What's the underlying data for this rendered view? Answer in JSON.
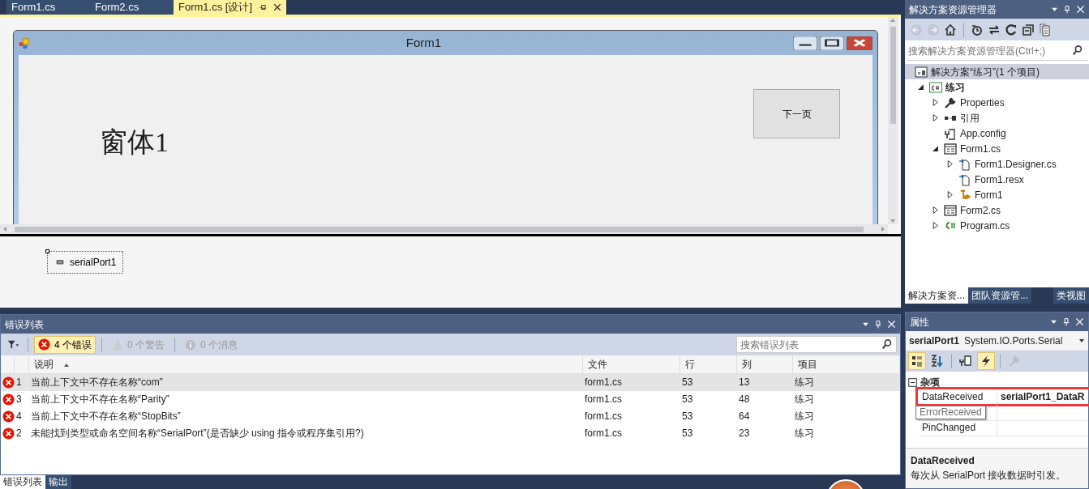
{
  "document_tabs": [
    {
      "label": "Form1.cs",
      "selected": false
    },
    {
      "label": "Form2.cs",
      "selected": false
    },
    {
      "label": "Form1.cs [设计]",
      "selected": true
    }
  ],
  "designer": {
    "form": {
      "title": "Form1",
      "label": "窗体1",
      "button": "下一页"
    },
    "tray": [
      {
        "label": "serialPort1",
        "selected": true
      }
    ]
  },
  "error_list": {
    "title": "错误列表",
    "filters": [
      {
        "kind": "error",
        "label": "4 个错误",
        "selected": true
      },
      {
        "kind": "warning",
        "label": "0 个警告",
        "selected": false
      },
      {
        "kind": "info",
        "label": "0 个消息",
        "selected": false
      }
    ],
    "search": {
      "placeholder": "搜索错误列表"
    },
    "columns": [
      "说明",
      "文件",
      "行",
      "列",
      "项目"
    ],
    "rows": [
      {
        "number": "1",
        "description": "当前上下文中不存在名称“com”",
        "file": "form1.cs",
        "line": "53",
        "column": "13",
        "project": "练习",
        "selected": true
      },
      {
        "number": "3",
        "description": "当前上下文中不存在名称“Parity”",
        "file": "form1.cs",
        "line": "53",
        "column": "48",
        "project": "练习",
        "selected": false
      },
      {
        "number": "4",
        "description": "当前上下文中不存在名称“StopBits”",
        "file": "form1.cs",
        "line": "53",
        "column": "64",
        "project": "练习",
        "selected": false
      },
      {
        "number": "2",
        "description": "未能找到类型或命名空间名称“SerialPort”(是否缺少 using 指令或程序集引用?)",
        "file": "form1.cs",
        "line": "53",
        "column": "23",
        "project": "练习",
        "selected": false
      }
    ]
  },
  "bottom_tabs": [
    {
      "label": "错误列表",
      "selected": true
    },
    {
      "label": "输出",
      "selected": false
    }
  ],
  "solution_explorer": {
    "title": "解决方案资源管理器",
    "toolbar": [
      {
        "kind": "back",
        "disabled": true
      },
      {
        "kind": "forward",
        "disabled": true
      },
      {
        "kind": "home",
        "disabled": false
      },
      {
        "kind": "history",
        "disabled": false
      },
      {
        "kind": "sync",
        "disabled": false
      },
      {
        "kind": "refresh",
        "disabled": false
      },
      {
        "kind": "collapse",
        "disabled": false
      },
      {
        "kind": "show-all",
        "disabled": false
      }
    ],
    "search": {
      "placeholder": "搜索解决方案资源管理器(Ctrl+;)"
    },
    "tree": [
      {
        "label": "解决方案“练习”(1 个项目)",
        "kind": "solution",
        "selected": true,
        "children": [
          {
            "label": "练习",
            "kind": "project",
            "expanded": true,
            "startup": true,
            "children": [
              {
                "label": "Properties",
                "kind": "wrench",
                "expanded": false
              },
              {
                "label": "引用",
                "kind": "references",
                "expanded": false
              },
              {
                "label": "App.config",
                "kind": "config"
              },
              {
                "label": "Form1.cs",
                "kind": "form",
                "expanded": true,
                "children": [
                  {
                    "label": "Form1.Designer.cs",
                    "kind": "code",
                    "expanded": false
                  },
                  {
                    "label": "Form1.resx",
                    "kind": "code"
                  },
                  {
                    "label": "Form1",
                    "kind": "class",
                    "expanded": false
                  }
                ]
              },
              {
                "label": "Form2.cs",
                "kind": "form",
                "expanded": false
              },
              {
                "label": "Program.cs",
                "kind": "csharp",
                "expanded": false
              }
            ]
          }
        ]
      }
    ],
    "tabs": [
      {
        "label": "解决方案资...",
        "selected": true
      },
      {
        "label": "团队资源管...",
        "selected": false
      },
      {
        "label": "类视图",
        "selected": false
      }
    ]
  },
  "properties": {
    "title": "属性",
    "object_name": "serialPort1",
    "object_type": "System.IO.Ports.Serial",
    "toolbar": [
      {
        "kind": "categorized",
        "selected": true,
        "disabled": false
      },
      {
        "kind": "alphabetical",
        "selected": false,
        "disabled": false
      },
      {
        "kind": "properties",
        "selected": false,
        "disabled": false
      },
      {
        "kind": "events",
        "selected": true,
        "disabled": false
      },
      {
        "kind": "pages",
        "selected": false,
        "disabled": true
      }
    ],
    "category": {
      "label": "杂项",
      "expanded": true
    },
    "rows": [
      {
        "name": "DataReceived",
        "value": "serialPort1_DataR",
        "outlined": true,
        "tooltip": false
      },
      {
        "name": "ErrorReceived",
        "outlined": false,
        "tooltip": true
      },
      {
        "name": "PinChanged",
        "outlined": false,
        "tooltip": false
      }
    ],
    "description": {
      "title": "DataReceived",
      "text": "每次从 SerialPort 接收数据时引发。"
    }
  }
}
